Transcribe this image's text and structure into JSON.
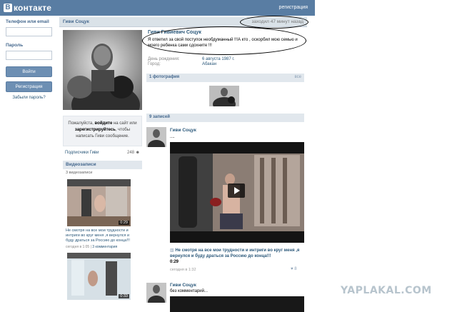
{
  "header": {
    "logo_letter": "В",
    "logo_text": "контакте",
    "register_link": "регистрация"
  },
  "login": {
    "phone_label": "Телефон или email",
    "password_label": "Пароль",
    "login_button": "Войти",
    "register_button": "Регистрация",
    "forgot_link": "Забыли пароль?"
  },
  "page": {
    "title": "Гиви Соцук",
    "online": "заходил 47 минут назад"
  },
  "profile": {
    "login_prompt_1": "Пожалуйста, ",
    "login_prompt_bold1": "войдите",
    "login_prompt_2": " на сайт или ",
    "login_prompt_bold2": "зарегистрируйтесь",
    "login_prompt_3": ", чтобы написать Гиви сообщение.",
    "subscribers_label": "Подписчики Гиви",
    "subscribers_count": "248",
    "videos_header": "Видеозаписи",
    "videos_count": "3 видеозаписи",
    "videos": [
      {
        "duration": "0:29",
        "title": "Не смотря на все мои трудности и интриги во круг меня ,я вернулся и буду драться за Россию до конца!!!",
        "date": "сегодня в 1:05",
        "comments": "3 комментария"
      },
      {
        "duration": "0:33",
        "title": "",
        "date": "",
        "comments": ""
      }
    ]
  },
  "info": {
    "full_name": "Гиви Гивиевич Соцук",
    "status": "Я ответил за свой поступок необдуманный !!!А кто , оскорбил мою семью и моего ребенка сами сдохните !!!",
    "birthday_label": "День рождения:",
    "birthday_value": "6 августа 1987 г.",
    "city_label": "Город:",
    "city_value": "Абакан",
    "photos_header": "1 фотография",
    "photos_all": "все",
    "wall_header": "9 записей"
  },
  "posts": [
    {
      "author": "Гиви Соцук",
      "text": "....",
      "video_title": "Не смотря на все мои трудности и интриги во круг меня ,я вернулся и буду драться за Россию до конца!!!",
      "duration": "0:29",
      "date": "сегодня в 1:32",
      "likes": "8"
    },
    {
      "author": "Гиви Соцук",
      "text": "без комментарий..."
    }
  ],
  "watermark": "YAPLAKAL.COM"
}
